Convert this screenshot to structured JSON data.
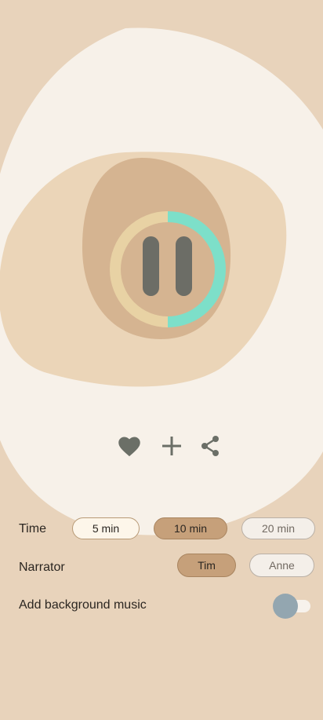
{
  "player": {
    "state": "playing",
    "progress": 0.5
  },
  "actions": {
    "like_icon": "heart-icon",
    "add_icon": "plus-icon",
    "share_icon": "share-icon"
  },
  "settings": {
    "time": {
      "label": "Time",
      "options": [
        "5 min",
        "10 min",
        "20 min"
      ],
      "selected": "10 min"
    },
    "narrator": {
      "label": "Narrator",
      "options": [
        "Tim",
        "Anne"
      ],
      "selected": "Tim"
    },
    "music": {
      "label": "Add background music",
      "enabled": false
    }
  },
  "colors": {
    "background": "#e8d3bb",
    "accent_progress": "#7ddfc9",
    "progress_track": "#e8d2a4",
    "icon": "#6b6f67",
    "toggle_thumb": "#93a6b0"
  }
}
